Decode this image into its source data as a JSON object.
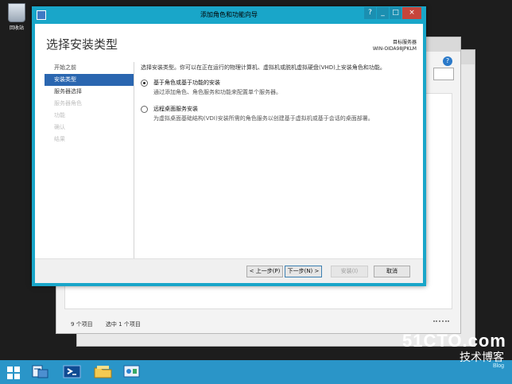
{
  "desktop": {
    "recycle_label": "回收站"
  },
  "wizard": {
    "window_title": "添加角色和功能向导",
    "page_title": "选择安装类型",
    "destination_label": "目标服务器",
    "destination_server": "WIN-OIDA98JPKLM",
    "nav": [
      {
        "label": "开始之前",
        "state": "normal"
      },
      {
        "label": "安装类型",
        "state": "active"
      },
      {
        "label": "服务器选择",
        "state": "normal"
      },
      {
        "label": "服务器角色",
        "state": "disabled"
      },
      {
        "label": "功能",
        "state": "disabled"
      },
      {
        "label": "确认",
        "state": "disabled"
      },
      {
        "label": "结果",
        "state": "disabled"
      }
    ],
    "intro": "选择安装类型。你可以在正在运行的物理计算机、虚拟机或脱机虚拟硬盘(VHD)上安装角色和功能。",
    "options": [
      {
        "title": "基于角色或基于功能的安装",
        "desc": "通过添加角色、角色服务和功能来配置单个服务器。",
        "selected": true
      },
      {
        "title": "远程桌面服务安装",
        "desc": "为虚拟桌面基础结构(VDI)安装所需的角色服务以创建基于虚拟机或基于会话的桌面部署。",
        "selected": false
      }
    ],
    "buttons": {
      "prev": "< 上一步(P)",
      "next": "下一步(N) >",
      "install": "安装(I)",
      "cancel": "取消"
    }
  },
  "background_window": {
    "item_count": "9 个项目",
    "selected_count": "选中 1 个项目",
    "help": "?"
  },
  "taskbar": {
    "items": [
      "start-icon",
      "server-manager-icon",
      "powershell-icon",
      "file-explorer-icon",
      "control-panel-icon"
    ]
  },
  "watermark": {
    "site": "51CTO.com",
    "label": "技术博客",
    "sub": "Blog"
  },
  "colors": {
    "wizard_frame": "#19a6c9",
    "taskbar": "#2a95c8",
    "selection": "#2a66b0",
    "close_button": "#c7453b"
  }
}
